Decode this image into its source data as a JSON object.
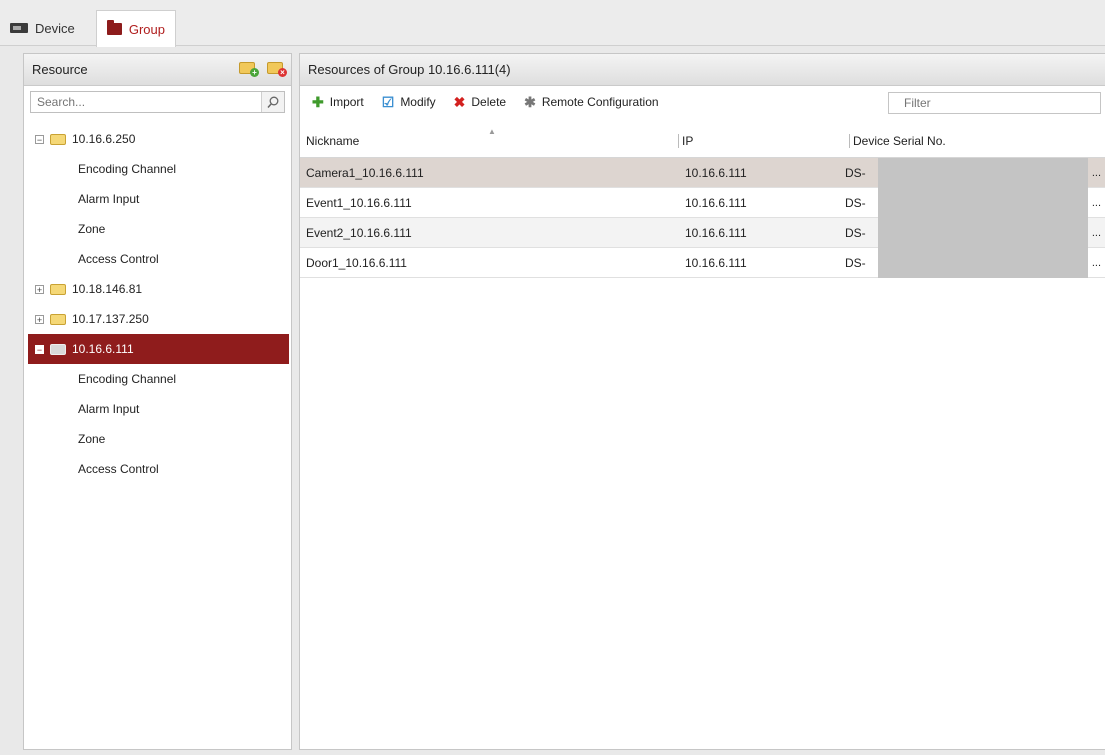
{
  "tabs": [
    {
      "label": "Device",
      "active": false,
      "icon": "device-icon"
    },
    {
      "label": "Group",
      "active": true,
      "icon": "group-folder-icon"
    }
  ],
  "resource_panel": {
    "title": "Resource",
    "search_placeholder": "Search...",
    "tree": [
      {
        "label": "10.16.6.250",
        "expanded": true,
        "children": [
          "Encoding Channel",
          "Alarm Input",
          "Zone",
          "Access Control"
        ]
      },
      {
        "label": "10.18.146.81",
        "expanded": false
      },
      {
        "label": "10.17.137.250",
        "expanded": false
      },
      {
        "label": "10.16.6.111",
        "expanded": true,
        "selected": true,
        "children": [
          "Encoding Channel",
          "Alarm Input",
          "Zone",
          "Access Control"
        ]
      }
    ]
  },
  "group_panel": {
    "title": "Resources of Group 10.16.6.111(4)",
    "toolbar": {
      "import": "Import",
      "modify": "Modify",
      "delete": "Delete",
      "remote": "Remote Configuration",
      "filter_placeholder": "Filter"
    },
    "columns": [
      "Nickname",
      "IP",
      "Device Serial No."
    ],
    "rows": [
      {
        "nickname": "Camera1_10.16.6.111",
        "ip": "10.16.6.111",
        "serial": "DS-",
        "ellipsis": "..."
      },
      {
        "nickname": "Event1_10.16.6.111",
        "ip": "10.16.6.111",
        "serial": "DS-",
        "ellipsis": "..."
      },
      {
        "nickname": "Event2_10.16.6.111",
        "ip": "10.16.6.111",
        "serial": "DS-",
        "ellipsis": "..."
      },
      {
        "nickname": "Door1_10.16.6.111",
        "ip": "10.16.6.111",
        "serial": "DS-",
        "ellipsis": "..."
      }
    ]
  },
  "colors": {
    "accent": "#8f1c1c",
    "tab_active_text": "#b01e1e",
    "selected_row": "#ddd5d0"
  }
}
